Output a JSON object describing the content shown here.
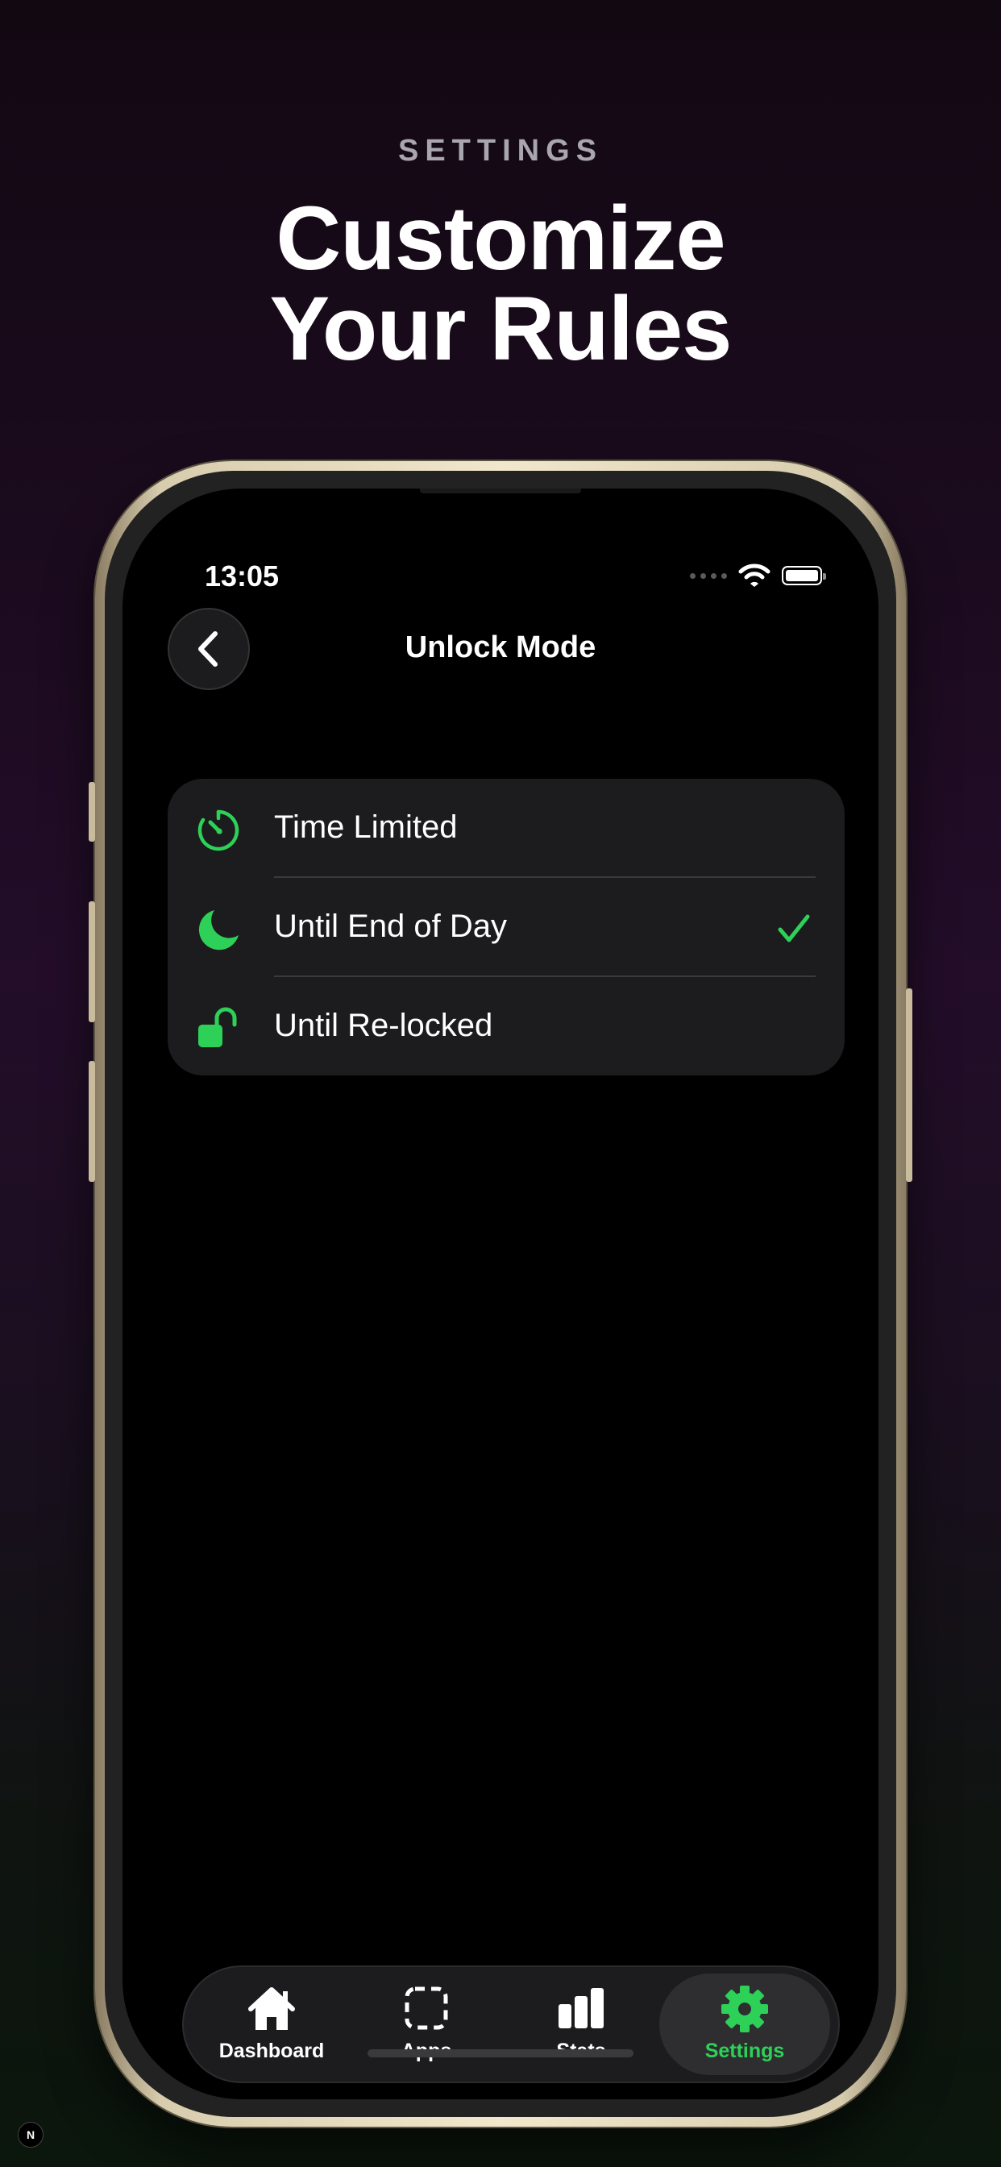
{
  "header": {
    "eyebrow": "SETTINGS",
    "title_line1": "Customize",
    "title_line2": "Your Rules"
  },
  "status_bar": {
    "time": "13:05",
    "icons": [
      "signal-dots-icon",
      "wifi-icon",
      "battery-icon"
    ]
  },
  "nav": {
    "back_icon": "chevron-left-icon",
    "title": "Unlock Mode"
  },
  "options": [
    {
      "label": "Time Limited",
      "icon": "timer-icon",
      "selected": false
    },
    {
      "label": "Until End of Day",
      "icon": "moon-icon",
      "selected": true
    },
    {
      "label": "Until Re-locked",
      "icon": "unlocked-padlock-icon",
      "selected": false
    }
  ],
  "tabbar": {
    "tabs": [
      {
        "label": "Dashboard",
        "icon": "house-icon",
        "active": false
      },
      {
        "label": "Apps",
        "icon": "dashed-square-icon",
        "active": false
      },
      {
        "label": "Stats",
        "icon": "bar-chart-icon",
        "active": false
      },
      {
        "label": "Settings",
        "icon": "gear-icon",
        "active": true
      }
    ]
  },
  "colors": {
    "accent": "#2ED158",
    "card_background": "#1C1C1E",
    "screen_background": "#000000"
  },
  "corner_badge": "N"
}
